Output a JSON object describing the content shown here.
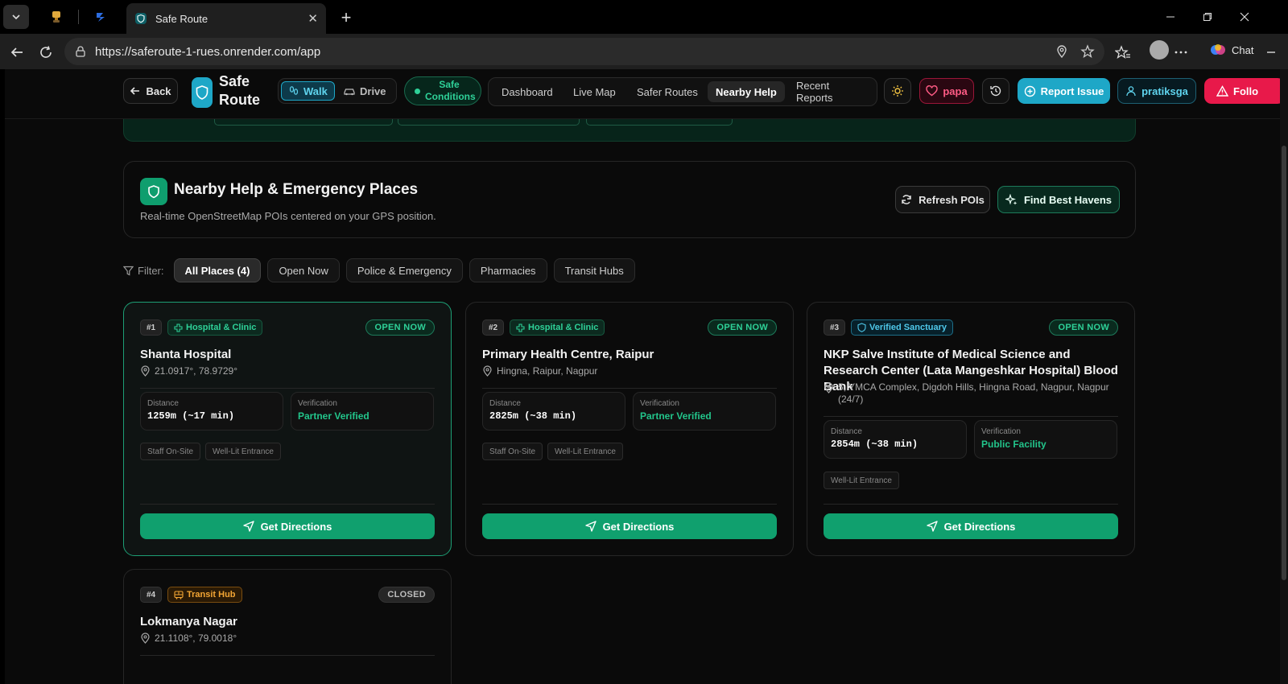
{
  "browser": {
    "tab_title": "Safe Route",
    "url": "https://saferoute-1-rues.onrender.com/app",
    "chat_label": "Chat"
  },
  "header": {
    "back_label": "Back",
    "brand": "Safe Route",
    "modes": [
      {
        "label": "Walk",
        "active": true
      },
      {
        "label": "Drive",
        "active": false
      }
    ],
    "conditions_label": "Safe Conditions",
    "nav": [
      {
        "label": "Dashboard"
      },
      {
        "label": "Live Map"
      },
      {
        "label": "Safer Routes"
      },
      {
        "label": "Nearby Help",
        "active": true
      },
      {
        "label": "Recent Reports"
      }
    ],
    "contact_label": "papa",
    "report_label": "Report Issue",
    "user_label": "pratiksga",
    "follow_label": "Follo"
  },
  "section": {
    "title": "Nearby Help & Emergency Places",
    "subtitle": "Real-time OpenStreetMap POIs centered on your GPS position.",
    "refresh_label": "Refresh POIs",
    "havens_label": "Find Best Havens"
  },
  "filter": {
    "label": "Filter:",
    "options": [
      {
        "label": "All Places (4)",
        "active": true
      },
      {
        "label": "Open Now"
      },
      {
        "label": "Police & Emergency"
      },
      {
        "label": "Pharmacies"
      },
      {
        "label": "Transit Hubs"
      }
    ]
  },
  "places": [
    {
      "rank": "#1",
      "category": "Hospital & Clinic",
      "status": "OPEN NOW",
      "name": "Shanta Hospital",
      "address": "21.0917°, 78.9729°",
      "distance_label": "Distance",
      "distance": "1259m (~17 min)",
      "verification_label": "Verification",
      "verification": "Partner Verified",
      "tags": [
        "Staff On-Site",
        "Well-Lit Entrance"
      ],
      "directions_label": "Get Directions"
    },
    {
      "rank": "#2",
      "category": "Hospital & Clinic",
      "status": "OPEN NOW",
      "name": "Primary Health Centre, Raipur",
      "address": "Hingna, Raipur, Nagpur",
      "distance_label": "Distance",
      "distance": "2825m (~38 min)",
      "verification_label": "Verification",
      "verification": "Partner Verified",
      "tags": [
        "Staff On-Site",
        "Well-Lit Entrance"
      ],
      "directions_label": "Get Directions"
    },
    {
      "rank": "#3",
      "category": "Verified Sanctuary",
      "status": "OPEN NOW",
      "name": "NKP Salve Institute of Medical Science and Research Center (Lata Mangeshkar Hospital) Blood Bank",
      "address": "5, YMCA Complex, Digdoh Hills, Hingna Road, Nagpur, Nagpur (24/7)",
      "distance_label": "Distance",
      "distance": "2854m (~38 min)",
      "verification_label": "Verification",
      "verification": "Public Facility",
      "tags": [
        "Well-Lit Entrance"
      ],
      "directions_label": "Get Directions"
    },
    {
      "rank": "#4",
      "category": "Transit Hub",
      "status": "CLOSED",
      "name": "Lokmanya Nagar",
      "address": "21.1108°, 79.0018°"
    }
  ],
  "colors": {
    "accent_green": "#10a06e",
    "accent_cyan": "#1ea7c7",
    "danger": "#e8194a"
  }
}
